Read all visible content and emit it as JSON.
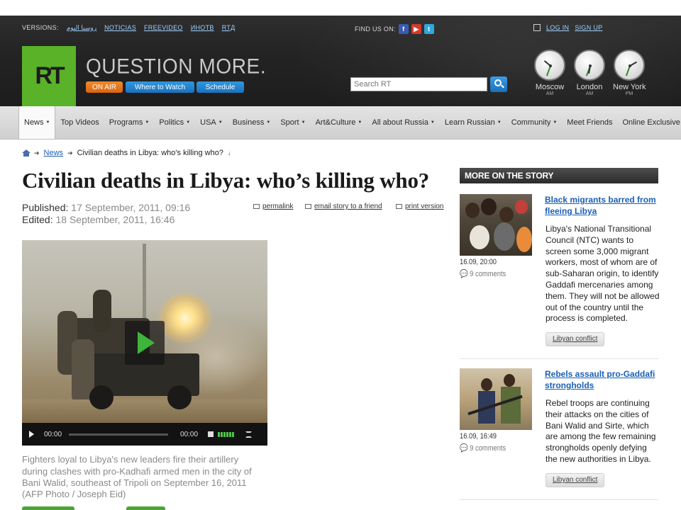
{
  "header": {
    "versions_label": "VERSIONS:",
    "versions": [
      "روسيا اليوم",
      "NOTICIAS",
      "FREEVIDEO",
      "ИНОТВ",
      "RTД"
    ],
    "find_us": "FIND US ON:",
    "social": [
      "facebook-icon",
      "youtube-icon",
      "twitter-icon"
    ],
    "login": "LOG IN",
    "signup": "SIGN UP",
    "logo": "RT",
    "slogan": "QUESTION MORE.",
    "buttons": {
      "on_air": "ON AIR",
      "where": "Where to Watch",
      "schedule": "Schedule"
    },
    "search_placeholder": "Search RT",
    "clocks": [
      {
        "city": "Moscow",
        "ampm": "AM"
      },
      {
        "city": "London",
        "ampm": "AM"
      },
      {
        "city": "New York",
        "ampm": "PM"
      }
    ],
    "brand_green": "#5ab229",
    "accent_orange": "#e8781c",
    "accent_blue": "#2383d1"
  },
  "nav": {
    "items": [
      "News",
      "Top Videos",
      "Programs",
      "Politics",
      "USA",
      "Business",
      "Sport",
      "Art&Culture",
      "All about Russia",
      "Learn Russian",
      "Community",
      "Meet Friends",
      "Online Exclusive"
    ],
    "active": "News"
  },
  "breadcrumb": {
    "section": "News",
    "current": "Civilian deaths in Libya: who's killing who?"
  },
  "article": {
    "headline": "Civilian deaths in Libya: who’s killing who?",
    "published_label": "Published:",
    "published": "17 September, 2011, 09:16",
    "edited_label": "Edited:",
    "edited": "18 September, 2011, 16:46",
    "tools": {
      "permalink": "permalink",
      "email": "email story to a friend",
      "print": "print version"
    },
    "video": {
      "time_current": "00:00",
      "time_total": "00:00"
    },
    "caption": "Fighters loyal to Libya's new leaders fire their artillery during clashes with pro-Kadhafi armed men in the city of Bani Walid, southeast of Tripoli on September 16, 2011",
    "caption_credit": "(AFP Photo / Joseph Eid)"
  },
  "sidebar": {
    "heading": "MORE ON THE STORY",
    "stories": [
      {
        "title": "Black migrants barred from fleeing Libya",
        "stamp": "16.09, 20:00",
        "comments": "9 comments",
        "body": "Libya's National Transitional Council (NTC) wants to screen some 3,000 migrant workers, most of whom are of sub-Saharan origin, to identify Gaddafi mercenaries among them. They will not be allowed out of the country until the process is completed.",
        "tag": "Libyan conflict"
      },
      {
        "title": "Rebels assault pro-Gaddafi strongholds",
        "stamp": "16.09, 16:49",
        "comments": "9 comments",
        "body": "Rebel troops are continuing their attacks on the cities of Bani Walid and Sirte, which are among the few remaining strongholds openly defying the new authorities in Libya.",
        "tag": "Libyan conflict"
      }
    ]
  }
}
